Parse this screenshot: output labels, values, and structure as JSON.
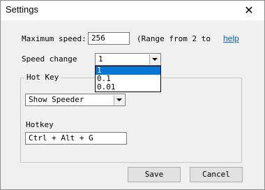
{
  "window": {
    "title": "Settings",
    "close_glyph": "✕"
  },
  "max_speed": {
    "label": "Maximum speed:",
    "value": "256",
    "range_note": "(Range from 2 to",
    "help_link": "help"
  },
  "speed_change": {
    "label": "Speed change",
    "selected": "1",
    "options": [
      "1",
      "0.1",
      "0.01"
    ],
    "highlighted_index": 0
  },
  "hotkey_group": {
    "caption": "Hot Key",
    "action_selected": "Show Speeder",
    "hotkey_label": "Hotkey",
    "hotkey_value": "Ctrl + Alt + G"
  },
  "buttons": {
    "save": "Save",
    "cancel": "Cancel"
  },
  "icons": {
    "close": "close-icon",
    "dropdown_arrow": "chevron-down-icon"
  },
  "colors": {
    "selection": "#0078d7",
    "link": "#0066cc",
    "dialog_bg": "#f0f0f0"
  }
}
